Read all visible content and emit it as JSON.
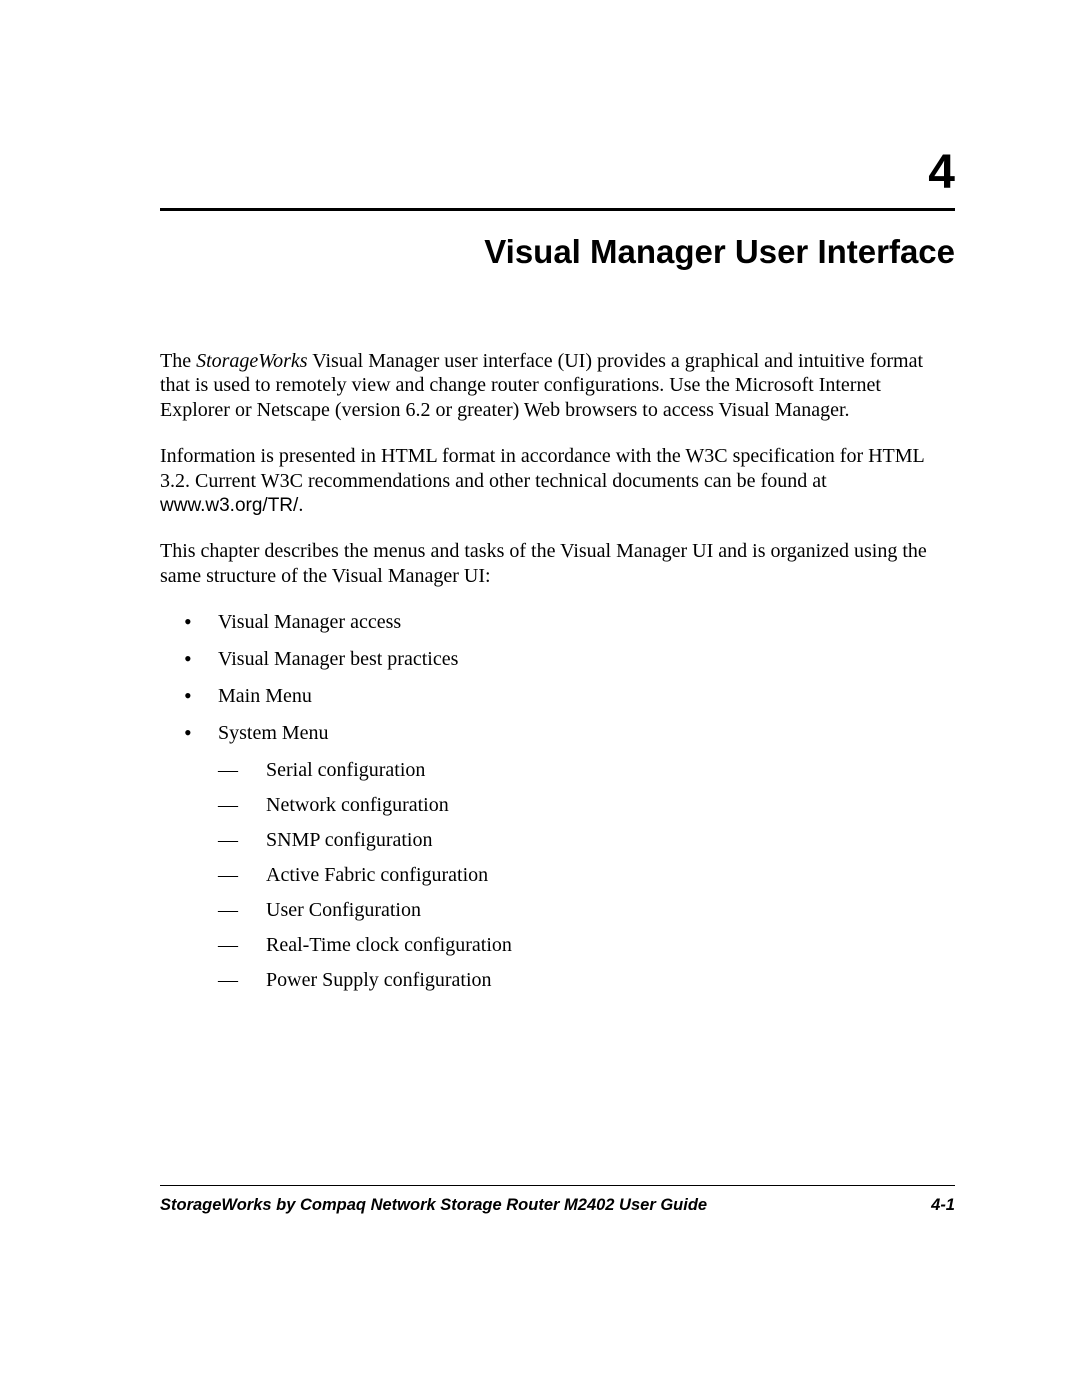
{
  "chapter": {
    "number": "4",
    "title": "Visual Manager User Interface"
  },
  "paragraphs": {
    "p1_pre": "The ",
    "p1_italic": "StorageWorks",
    "p1_post": " Visual Manager user interface (UI) provides a graphical and intuitive format that is used to remotely view and change router configurations. Use the Microsoft Internet Explorer or Netscape (version 6.2 or greater) Web browsers to access Visual Manager.",
    "p2_pre": "Information is presented in HTML format in accordance with the W3C specification for HTML 3.2. Current W3C recommendations and other technical documents can be found at ",
    "p2_url": "www.w3.org/TR/",
    "p2_post": ".",
    "p3": "This chapter describes the menus and tasks of the Visual Manager UI and is organized using the same structure of the Visual Manager UI:"
  },
  "bullets": {
    "b1": "Visual Manager access",
    "b2": "Visual Manager best practices",
    "b3": "Main Menu",
    "b4": "System Menu",
    "sub": {
      "s1": "Serial configuration",
      "s2": "Network configuration",
      "s3": "SNMP configuration",
      "s4": "Active Fabric configuration",
      "s5": "User Configuration",
      "s6": "Real-Time clock configuration",
      "s7": "Power Supply configuration"
    }
  },
  "footer": {
    "left": "StorageWorks by Compaq Network Storage Router M2402 User Guide",
    "right": "4-1"
  }
}
